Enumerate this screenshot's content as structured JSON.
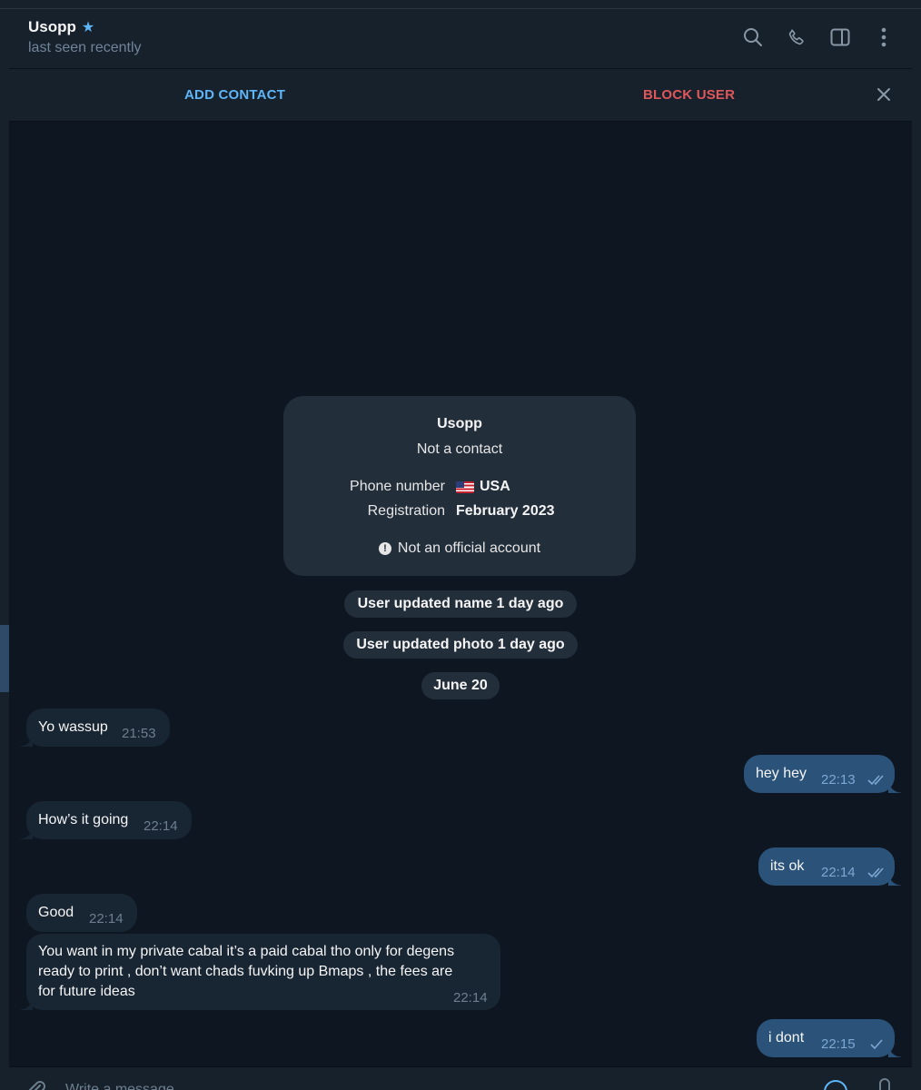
{
  "header": {
    "name": "Usopp",
    "status": "last seen recently",
    "icons": [
      "star-icon",
      "search-icon",
      "phone-icon",
      "sidebar-icon",
      "more-icon"
    ]
  },
  "actionbar": {
    "add_contact": "ADD CONTACT",
    "block_user": "BLOCK USER"
  },
  "info_card": {
    "name": "Usopp",
    "subtitle": "Not a contact",
    "phone_label": "Phone number",
    "phone_value": "USA",
    "registration_label": "Registration",
    "registration_value": "February 2023",
    "warning": "Not an official account"
  },
  "service": {
    "name_update": "User updated name 1 day ago",
    "photo_update": "User updated photo 1 day ago",
    "date": "June 20"
  },
  "messages": [
    {
      "dir": "in",
      "text": "Yo wassup",
      "time": "21:53"
    },
    {
      "dir": "out",
      "text": "hey hey",
      "time": "22:13",
      "status": "read"
    },
    {
      "dir": "in",
      "text": "How’s it going",
      "time": "22:14"
    },
    {
      "dir": "out",
      "text": "its ok",
      "time": "22:14",
      "status": "read"
    },
    {
      "dir": "in",
      "text": "Good",
      "time": "22:14"
    },
    {
      "dir": "in",
      "text_lines": [
        "You want in my private cabal it’s a paid cabal tho only for degens",
        "ready to print , don’t want chads fuvking up Bmaps , the fees are",
        "for future ideas"
      ],
      "time": "22:14"
    },
    {
      "dir": "out",
      "text": "i dont",
      "time": "22:15",
      "status": "sent"
    }
  ],
  "composer": {
    "placeholder": "Write a message..."
  },
  "colors": {
    "background": "#0e1621",
    "panel": "#17212b",
    "incoming": "#182533",
    "outgoing": "#2b5278",
    "accent": "#5eb5f7",
    "danger": "#e0575b"
  }
}
